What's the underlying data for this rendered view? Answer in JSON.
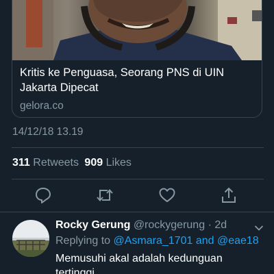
{
  "card": {
    "title": "Kritis ke Penguasa, Seorang PNS di UIN Jakarta Dipecat",
    "domain": "gelora.co"
  },
  "tweet": {
    "timestamp": "14/12/18 13.19",
    "retweets_count": "311",
    "retweets_label": "Retweets",
    "likes_count": "909",
    "likes_label": "Likes"
  },
  "icons": {
    "reply": "reply-icon",
    "retweet": "retweet-icon",
    "like": "heart-icon",
    "share": "share-icon",
    "caret": "chevron-down-icon"
  },
  "reply": {
    "name": "Rocky Gerung",
    "handle": "@rockygerung",
    "separator": "·",
    "age": "2d",
    "replying_prefix": "Replying to",
    "mention1": "@Asmara_1701",
    "mention_joiner": "and",
    "mention2": "@eae18",
    "body": "Memusuhi akal adalah kedunguan tertinggi."
  },
  "colors": {
    "background": "#15202b",
    "secondary_text": "#8899a6",
    "accent": "#1da1f2",
    "divider": "#38444d"
  }
}
